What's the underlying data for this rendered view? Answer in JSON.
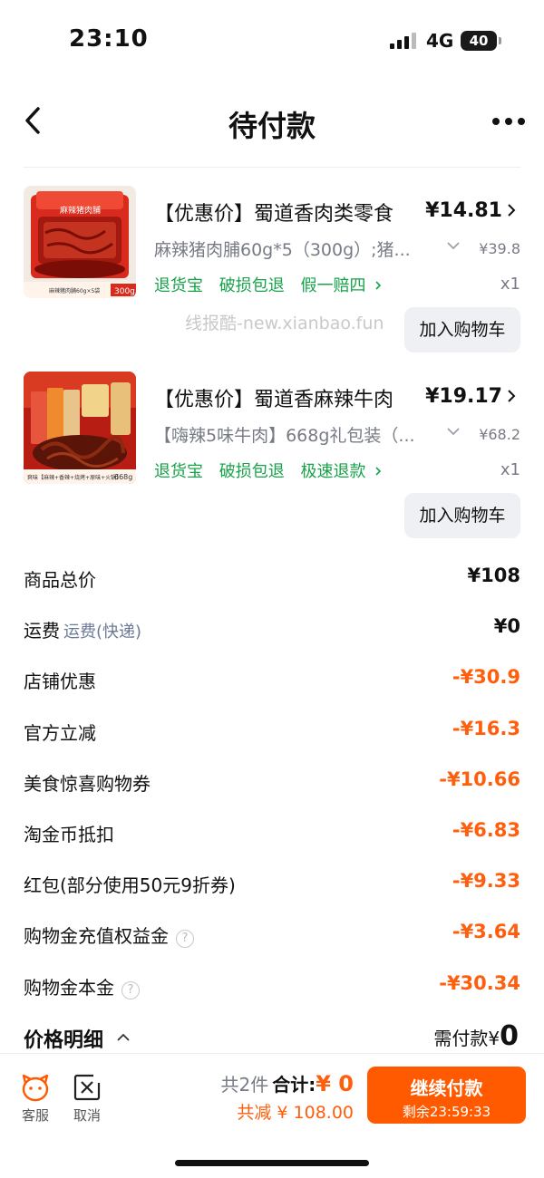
{
  "status_bar": {
    "time": "23:10",
    "network": "4G",
    "battery": "40"
  },
  "nav": {
    "title": "待付款"
  },
  "products": [
    {
      "title": "【优惠价】蜀道香肉类零食",
      "price": "¥14.81",
      "spec": "麻辣猪肉脯60g*5（300g）;猪...",
      "original_price": "¥39.8",
      "tags": [
        "退货宝",
        "破损包退",
        "假一赔四"
      ],
      "quantity": "x1",
      "cart_button": "加入购物车",
      "thumb_top_label": "麻辣猪肉脯",
      "thumb_bottom_label": "麻辣猪肉脯60g×5袋",
      "thumb_weight": "300g"
    },
    {
      "title": "【优惠价】蜀道香麻辣牛肉",
      "price": "¥19.17",
      "spec": "【嗨辣5味牛肉】668g礼包装（...",
      "original_price": "¥68.2",
      "tags": [
        "退货宝",
        "破损包退",
        "极速退款"
      ],
      "quantity": "x1",
      "cart_button": "加入购物车",
      "thumb_bottom_label": "爽味【麻辣+香辣+烧烤+原味+火锅】",
      "thumb_weight": "668g"
    }
  ],
  "watermark": "线报酷-new.xianbao.fun",
  "price_rows": [
    {
      "label": "商品总价",
      "sub": "",
      "value": "¥108",
      "negative": false,
      "help": false
    },
    {
      "label": "运费",
      "sub": "运费(快递)",
      "value": "¥0",
      "negative": false,
      "help": false
    },
    {
      "label": "店铺优惠",
      "sub": "",
      "value": "-¥30.9",
      "negative": true,
      "help": false
    },
    {
      "label": "官方立减",
      "sub": "",
      "value": "-¥16.3",
      "negative": true,
      "help": false
    },
    {
      "label": "美食惊喜购物券",
      "sub": "",
      "value": "-¥10.66",
      "negative": true,
      "help": false
    },
    {
      "label": "淘金币抵扣",
      "sub": "",
      "value": "-¥6.83",
      "negative": true,
      "help": false
    },
    {
      "label": "红包(部分使用50元9折券)",
      "sub": "",
      "value": "-¥9.33",
      "negative": true,
      "help": false
    },
    {
      "label": "购物金充值权益金",
      "sub": "",
      "value": "-¥3.64",
      "negative": true,
      "help": true
    },
    {
      "label": "购物金本金",
      "sub": "",
      "value": "-¥30.34",
      "negative": true,
      "help": true
    }
  ],
  "help_glyph": "?",
  "detail": {
    "label": "价格明细",
    "need_pay_label": "需付款¥",
    "need_pay_value": "0"
  },
  "bottom_bar": {
    "service_label": "客服",
    "cancel_label": "取消",
    "count_text": "共2件",
    "total_label": "合计:",
    "total_amount": "¥ 0",
    "saved_text": "共减 ¥ 108.00",
    "pay_button": "继续付款",
    "countdown": "剩余23:59:33"
  },
  "colors": {
    "accent": "#ff5a00",
    "discount": "#ff5e0c",
    "tag_green": "#17a34a",
    "muted": "#777b86"
  }
}
